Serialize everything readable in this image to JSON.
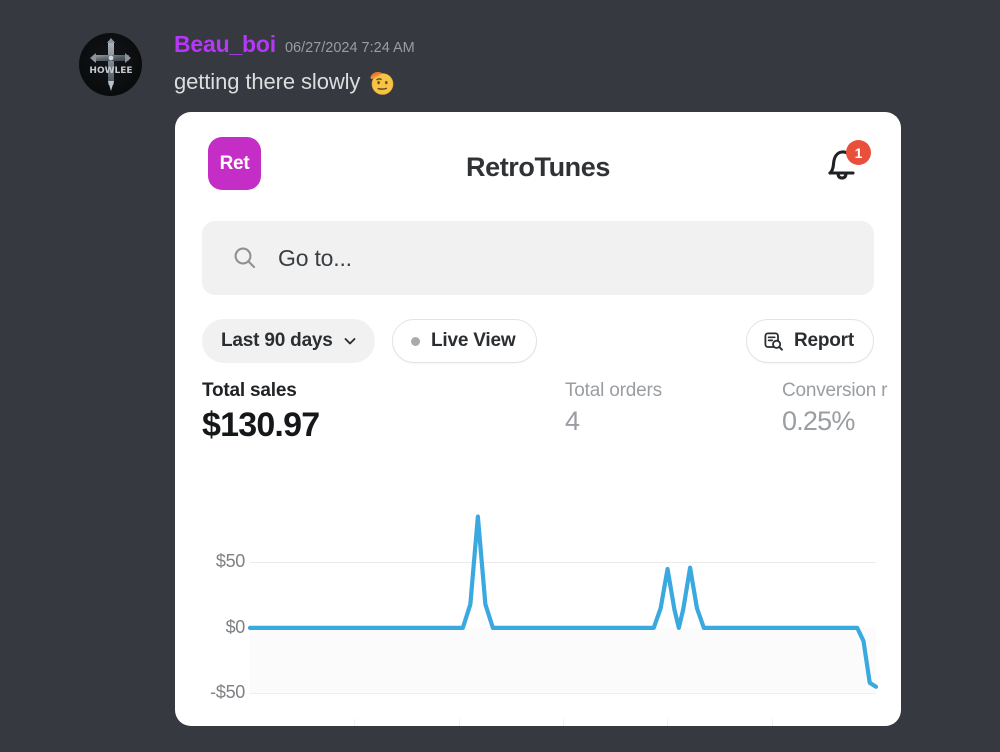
{
  "discord": {
    "author": "Beau_boi",
    "timestamp": "06/27/2024 7:24 AM",
    "message_text": "getting there slowly",
    "emoji_name": "raised-eyebrow-beret-emoji",
    "avatar_name": "user-avatar",
    "author_color": "#b438f5",
    "background_color": "#36393F"
  },
  "app": {
    "logo_label": "Ret",
    "logo_color": "#c42ec6",
    "title": "RetroTunes",
    "notifications": {
      "icon": "bell-icon",
      "badge_count": "1",
      "badge_color": "#e8503b"
    },
    "search": {
      "icon": "search-icon",
      "placeholder": "Go to...",
      "value": ""
    },
    "filters": {
      "date_range_label": "Last 90 days",
      "date_range_chevron": "chevron-down-icon",
      "live_view_label": "Live View",
      "live_view_dot_color": "#a8abae",
      "report_label": "Report",
      "report_icon": "report-document-search-icon"
    },
    "metrics": [
      {
        "label": "Total sales",
        "value": "$130.97"
      },
      {
        "label": "Total orders",
        "value": "4"
      },
      {
        "label": "Conversion r",
        "value": "0.25%"
      }
    ]
  },
  "chart_data": {
    "type": "line",
    "title": "",
    "xlabel": "",
    "ylabel": "",
    "ylim": [
      -75,
      100
    ],
    "yticks": [
      50,
      0,
      -50
    ],
    "ytick_labels": [
      "$50",
      "$0",
      "-$50"
    ],
    "grid": true,
    "legend": "none",
    "line_color": "#3aa9e0",
    "area_fill": "#fbfbfc",
    "series": [
      {
        "name": "Total sales",
        "x": [
          0,
          10,
          20,
          30,
          34,
          35.2,
          36.4,
          37.6,
          38.8,
          40,
          50,
          60,
          64.5,
          65.6,
          66.7,
          67.8,
          68.5,
          69.2,
          70.3,
          71.4,
          72.5,
          73.6,
          80,
          90,
          96,
          97,
          98,
          99,
          100
        ],
        "values": [
          0,
          0,
          0,
          0,
          0,
          18,
          85,
          18,
          0,
          0,
          0,
          0,
          0,
          15,
          45,
          14,
          0,
          14,
          46,
          15,
          0,
          0,
          0,
          0,
          0,
          0,
          -10,
          -42,
          -45
        ]
      }
    ]
  }
}
